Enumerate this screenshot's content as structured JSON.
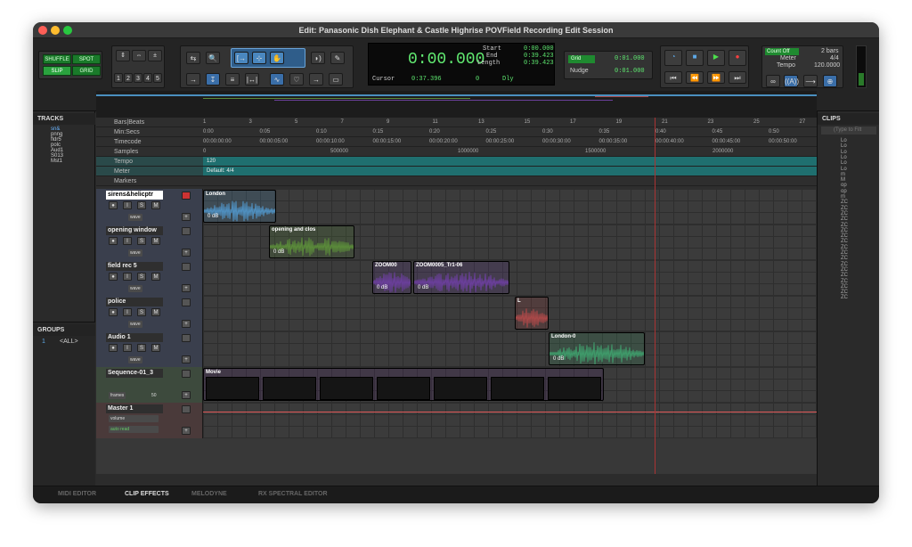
{
  "window": {
    "title": "Edit: Panasonic Dish Elephant & Castle Highrise POVField Recording Edit Session"
  },
  "edit_modes": {
    "shuffle": "SHUFFLE",
    "spot": "SPOT",
    "slip": "SLIP",
    "grid": "GRID"
  },
  "zoom_presets": [
    "1",
    "2",
    "3",
    "4",
    "5"
  ],
  "counter": {
    "main": "0:00.000",
    "start_label": "Start",
    "start": "0:00.000",
    "end_label": "End",
    "end": "0:39.423",
    "length_label": "Length",
    "length": "0:39.423",
    "cursor_label": "Cursor",
    "cursor": "0:37.396",
    "cursor_sample": "0",
    "dly": "Dly"
  },
  "grid": {
    "label": "Grid",
    "value": "0:01.000",
    "nudge_label": "Nudge",
    "nudge_value": "0:01.000"
  },
  "count": {
    "label": "Count Off",
    "value": "2 bars",
    "meter_label": "Meter",
    "meter": "4/4",
    "tempo_label": "Tempo",
    "tempo": "120.0000"
  },
  "panels": {
    "tracks": "TRACKS",
    "groups": "GROUPS",
    "clips": "CLIPS",
    "clips_filter": "(Type to Filt",
    "group_all": "<ALL>",
    "group_num": "1"
  },
  "track_list": [
    "sn&",
    "pnng",
    "fldr5",
    "polc",
    "Aud1",
    "S013",
    "Mst1"
  ],
  "rulers": {
    "bars_label": "Bars|Beats",
    "min_label": "Min:Secs",
    "timecode_label": "Timecode",
    "samples_label": "Samples",
    "tempo_label": "Tempo",
    "meter_label": "Meter",
    "markers_label": "Markers",
    "tempo_value": "120",
    "meter_value": "Default: 4/4"
  },
  "bars": [
    "1",
    "3",
    "5",
    "7",
    "9",
    "11",
    "13",
    "15",
    "17",
    "19",
    "21",
    "23",
    "25",
    "27"
  ],
  "minsecs": [
    "0:00",
    "0:05",
    "0:10",
    "0:15",
    "0:20",
    "0:25",
    "0:30",
    "0:35",
    "0:40",
    "0:45",
    "0:50"
  ],
  "timecodes": [
    "00:00:00:00",
    "00:00:05:00",
    "00:00:10:00",
    "00:00:15:00",
    "00:00:20:00",
    "00:00:25:00",
    "00:00:30:00",
    "00:00:35:00",
    "00:00:40:00",
    "00:00:45:00",
    "00:00:50:00"
  ],
  "samples": [
    "0",
    "500000",
    "1000000",
    "1500000",
    "2000000"
  ],
  "tracks": [
    {
      "name": "sirens&helicptr",
      "mode": "wave",
      "clips": [
        {
          "name": "London",
          "gain": "0 dB",
          "color": "#4f8fbf"
        }
      ]
    },
    {
      "name": "opening window",
      "mode": "wave",
      "clips": [
        {
          "name": "opening and clos",
          "gain": "0 dB",
          "color": "#5a8a3a"
        }
      ]
    },
    {
      "name": "field rec 5",
      "mode": "wave",
      "clips": [
        {
          "name": "ZOOM00",
          "gain": "0 dB",
          "color": "#6a3f9a"
        },
        {
          "name": "ZOOM0005_Tr1-06",
          "gain": "0 dB",
          "color": "#6a3f9a"
        }
      ]
    },
    {
      "name": "police",
      "mode": "wave",
      "clips": [
        {
          "name": "L",
          "gain": "",
          "color": "#a84848"
        }
      ]
    },
    {
      "name": "Audio 1",
      "mode": "wave",
      "clips": [
        {
          "name": "London-0",
          "gain": "0 dB",
          "color": "#3f9a6a"
        }
      ]
    },
    {
      "name": "Sequence-01_3",
      "mode": "frames",
      "extra": "50",
      "clips": [
        {
          "name": "Movie",
          "gain": "",
          "color": "#5b2f7a"
        }
      ]
    },
    {
      "name": "Master 1",
      "mode": "volume",
      "auto": "auto read",
      "clips": []
    }
  ],
  "bottom_tabs": [
    "MIDI EDITOR",
    "CLIP EFFECTS",
    "MELODYNE",
    "RX SPECTRAL EDITOR"
  ],
  "clip_list": [
    "Lo",
    "Lo",
    "Lo",
    "Lo",
    "Lo",
    "Lo",
    "m",
    "M",
    "op",
    "op",
    "m",
    "ZC",
    "ZC",
    "ZC",
    "ZC",
    "ZC",
    "ZC",
    "ZC",
    "ZC",
    "ZC",
    "ZC",
    "ZC",
    "ZC",
    "ZC",
    "ZC",
    "ZC",
    "ZC",
    "ZC",
    "ZC"
  ]
}
